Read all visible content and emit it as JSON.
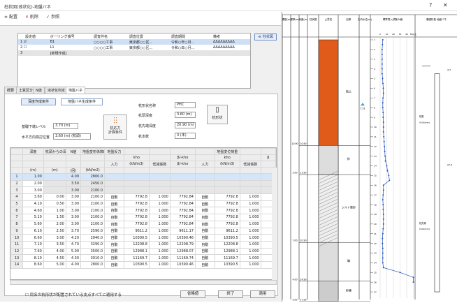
{
  "window": {
    "title": "柱状図(液状化)-地盤バネ",
    "help": "?",
    "close": "✕"
  },
  "toolbar": {
    "items": [
      {
        "icon": "±",
        "label": "配置"
      },
      {
        "icon": "✕",
        "label": "削除"
      },
      {
        "icon": "✓",
        "label": "参照"
      }
    ]
  },
  "boreholes": {
    "headers": [
      "設定値",
      "ボーリング番号",
      "調査件名",
      "調査位置",
      "調査期間",
      "備考"
    ],
    "rows": [
      {
        "no": "1",
        "check": "☑",
        "id": "B1",
        "name": "○○○○工事",
        "pos": "東京都○○区...",
        "period": "令和○年○月...",
        "note": "ΔΔΔΔΔΔΔΔΔ"
      },
      {
        "no": "2",
        "check": "☐",
        "id": "L1",
        "name": "○○○○工事",
        "pos": "東京都○○区...",
        "period": "令和○年○月...",
        "note": "ΔΔΔΔΔΔΔΔΔ"
      },
      {
        "no": "3",
        "check": "",
        "id": "[新規作成]",
        "name": "",
        "pos": "",
        "period": "",
        "note": ""
      }
    ]
  },
  "cross_button": "≪ 柱状図",
  "tabs": [
    "概要",
    "土質区分",
    "N値",
    "液状化判定",
    "地盤バネ"
  ],
  "form": {
    "depth_condition_btn": "深度作成条件",
    "spring_condition_btn": "地盤バネ生成条件",
    "head_level_label": "基礎下端レベル",
    "head_level_value": "3.70 (m)",
    "water_level_label": "水平方向検討位置",
    "water_level_value": "3.60 (m) (杭頭)",
    "calc_label": "杭応力\n計算条件",
    "pile_name_label": "杭形状名称",
    "pile_name_value": "PHC",
    "pile_depth_label": "杭頭深度",
    "pile_depth_value": "3.60 (m)",
    "pile_tip_label": "杭先端深度",
    "pile_tip_value": "20.90 (m)",
    "pile_count_label": "杭本数",
    "pile_count_value": "3 (本)",
    "pile_shape_btn": "杭形状"
  },
  "grid": {
    "h1": [
      "",
      "深度",
      "杭頭からの深度",
      "N値",
      "地盤変形係数E0",
      "地盤反力",
      "",
      "",
      "",
      "",
      "地盤変位荷重",
      "",
      ""
    ],
    "h2": [
      "",
      "",
      "",
      "",
      "",
      "",
      "kho",
      "",
      "β/-kho",
      "",
      "kho",
      "",
      "β"
    ],
    "h3": [
      "",
      "",
      "",
      "",
      "",
      "入力",
      "(kN/m3)",
      "低減係数",
      "β/-kho",
      "入力",
      "(kN/m3)",
      "低減係数",
      ""
    ],
    "units": [
      "",
      "(m)",
      "(m)",
      "(回)",
      "(kN/m2)",
      "",
      "",
      "",
      "",
      "",
      "",
      "",
      ""
    ],
    "rows": [
      [
        "1",
        "1.00",
        "",
        "4.00",
        "2800.0",
        "",
        "",
        "",
        "",
        "",
        "",
        "",
        ""
      ],
      [
        "2",
        "2.00",
        "",
        "3.50",
        "2450.0",
        "",
        "",
        "",
        "",
        "",
        "",
        "",
        ""
      ],
      [
        "3",
        "3.00",
        "",
        "3.00",
        "2100.0",
        "",
        "",
        "",
        "",
        "",
        "",
        "",
        ""
      ],
      [
        "4",
        "3.60",
        "0.00",
        "3.00",
        "2100.0",
        "自動",
        "7792.8",
        "1.000",
        "7792.84",
        "自動",
        "7792.8",
        "1.000",
        ""
      ],
      [
        "5",
        "4.10",
        "0.50",
        "3.00",
        "2100.0",
        "自動",
        "7792.8",
        "1.000",
        "7792.84",
        "自動",
        "7792.8",
        "1.000",
        ""
      ],
      [
        "6",
        "4.60",
        "1.00",
        "3.00",
        "2100.0",
        "自動",
        "7792.8",
        "1.000",
        "7792.84",
        "自動",
        "7792.8",
        "1.000",
        ""
      ],
      [
        "7",
        "5.10",
        "1.50",
        "3.00",
        "2100.0",
        "自動",
        "7792.8",
        "1.000",
        "7792.84",
        "自動",
        "7792.8",
        "1.000",
        ""
      ],
      [
        "8",
        "5.60",
        "2.00",
        "3.00",
        "2100.0",
        "自動",
        "7792.8",
        "1.000",
        "7792.84",
        "自動",
        "7792.8",
        "1.000",
        ""
      ],
      [
        "9",
        "6.10",
        "2.50",
        "3.70",
        "2590.0",
        "自動",
        "9611.2",
        "1.000",
        "9611.17",
        "自動",
        "9611.2",
        "1.000",
        ""
      ],
      [
        "10",
        "6.60",
        "3.00",
        "4.20",
        "2940.0",
        "自動",
        "10390.5",
        "1.000",
        "10390.46",
        "自動",
        "10390.5",
        "1.000",
        ""
      ],
      [
        "11",
        "7.10",
        "3.50",
        "4.70",
        "3290.0",
        "自動",
        "12208.8",
        "1.000",
        "12208.79",
        "自動",
        "12208.8",
        "1.000",
        ""
      ],
      [
        "12",
        "7.60",
        "4.00",
        "5.00",
        "3500.0",
        "自動",
        "12988.1",
        "1.000",
        "12988.07",
        "自動",
        "12988.1",
        "1.000",
        ""
      ],
      [
        "13",
        "8.10",
        "4.50",
        "4.30",
        "3010.0",
        "自動",
        "11169.7",
        "1.000",
        "11169.74",
        "自動",
        "11169.7",
        "1.000",
        ""
      ],
      [
        "14",
        "8.60",
        "5.00",
        "4.00",
        "2800.0",
        "自動",
        "10390.5",
        "1.000",
        "10390.46",
        "自動",
        "10390.5",
        "1.000",
        ""
      ]
    ]
  },
  "bottom": {
    "checkbox": "同名の杭形状が配置されている支点すべてに適用する",
    "check_btn": "省略値",
    "ok": "終了",
    "apply": "適用"
  },
  "log": {
    "col_headers": [
      "標高(m)",
      "層厚(m)",
      "深度(m)",
      "柱状図",
      "土質名",
      "記事",
      "孔内水位(m)",
      "標準貫入試験 N値",
      "基礎杭長 地盤バネ"
    ],
    "water_level": "7.51",
    "soils": [
      {
        "name": "粘土"
      },
      {
        "name": "砂"
      },
      {
        "name": "シルト質砂"
      },
      {
        "name": "礫"
      },
      {
        "name": "砂礫"
      }
    ],
    "nvalue_axis": [
      "0",
      "10",
      "20",
      "30",
      "40",
      "50以上"
    ],
    "depth_labels": [
      "1",
      "2",
      "3",
      "4",
      "5",
      "6",
      "7",
      "8",
      "9",
      "10",
      "11",
      "12",
      "13",
      "14",
      "15",
      "16",
      "17",
      "18",
      "19",
      "20",
      "21",
      "22",
      "23",
      "24",
      "25",
      "26",
      "27"
    ],
    "layer_labels": [
      {
        "top": "10.90",
        "thk": "10.90"
      },
      {
        "top": "3.00",
        "thk": "13.90"
      },
      {
        "top": "7.00",
        "thk": "20.90"
      },
      {
        "top": "4.00",
        "thk": "24.90"
      },
      {
        "top": "3.00",
        "thk": "27.90"
      }
    ],
    "pile_labels": [
      "3.7",
      "杭頭",
      "9.00(mm)",
      "27.0",
      "杭先端",
      "9.00(mm)"
    ],
    "n_values": [
      4,
      3.5,
      3,
      3,
      3,
      3,
      3,
      3,
      3.7,
      4.2,
      4.7,
      5,
      4.3,
      4,
      4,
      4.5,
      4.5,
      5,
      5,
      5,
      5.5,
      6,
      6.5,
      7,
      7.5,
      8,
      10,
      11,
      13,
      14,
      5,
      5,
      4.5,
      4,
      4.5,
      4.5,
      5,
      5,
      5,
      4.5,
      4,
      3.5,
      3.5,
      4,
      4,
      4,
      4,
      5,
      30,
      50,
      50
    ]
  }
}
